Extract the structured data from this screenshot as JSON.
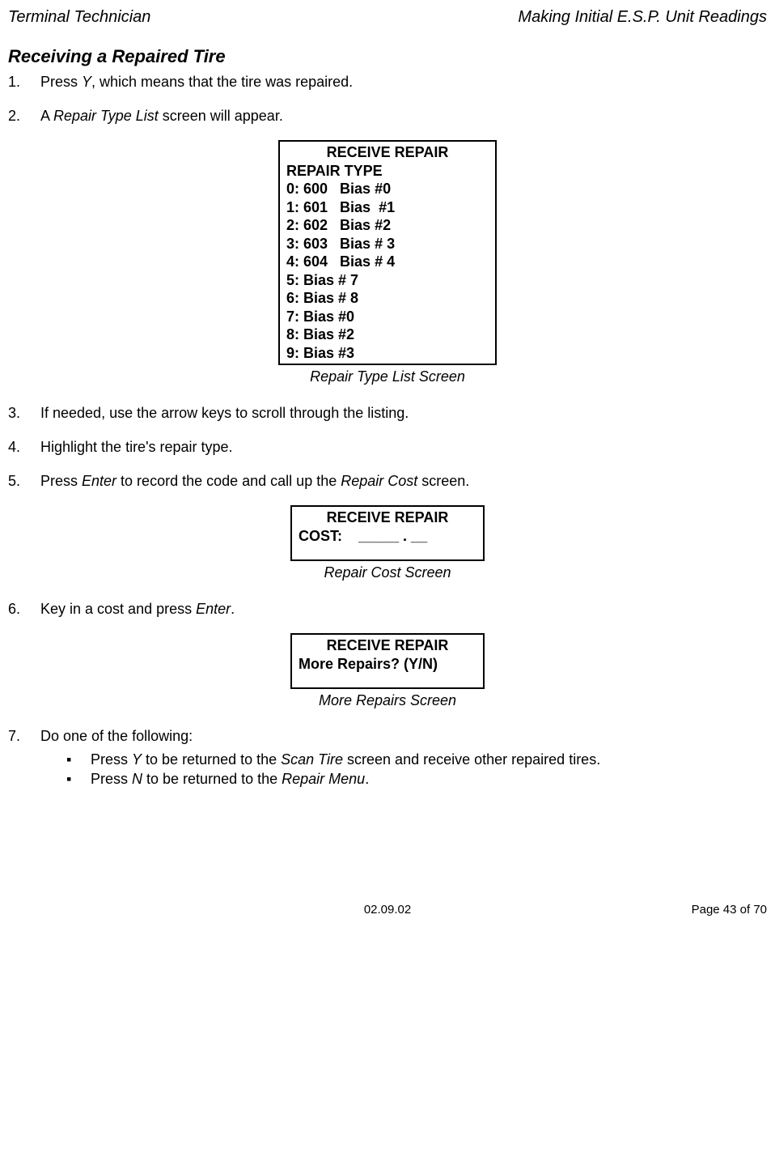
{
  "header": {
    "left": "Terminal Technician",
    "right": "Making Initial E.S.P. Unit Readings"
  },
  "sectionHeading": "Receiving a Repaired Tire",
  "steps": {
    "s1": {
      "num": "1.",
      "t1": "Press ",
      "key": "Y",
      "t2": ", which means that the tire was repaired."
    },
    "s2": {
      "num": "2.",
      "t1": "A ",
      "em": "Repair Type List",
      "t2": " screen will appear."
    },
    "s3": {
      "num": "3.",
      "t": "If needed, use the arrow keys to scroll through the listing."
    },
    "s4": {
      "num": "4.",
      "t": "Highlight the tire's repair type."
    },
    "s5": {
      "num": "5.",
      "t1": "Press ",
      "em1": "Enter",
      "t2": " to record the code and call up the ",
      "em2": "Repair Cost",
      "t3": " screen."
    },
    "s6": {
      "num": "6.",
      "t1": "Key in a cost and press ",
      "em": "Enter",
      "t2": "."
    },
    "s7": {
      "num": "7.",
      "t": "Do one of the following:",
      "b1": {
        "t1": "Press ",
        "key": "Y",
        "t2": " to be returned to the ",
        "em": "Scan Tire",
        "t3": " screen and receive other repaired tires."
      },
      "b2": {
        "t1": "Press ",
        "key": "N",
        "t2": " to be returned to the ",
        "em": "Repair Menu",
        "t3": "."
      }
    }
  },
  "screens": {
    "repairType": {
      "title": "RECEIVE REPAIR",
      "sub": "REPAIR TYPE",
      "r0": "0: 600   Bias #0",
      "r1": "1: 601   Bias  #1",
      "r2": "2: 602   Bias #2",
      "r3": "3: 603   Bias # 3",
      "r4": "4: 604   Bias # 4",
      "r5": "5: Bias # 7",
      "r6": "6: Bias # 8",
      "r7": "7: Bias #0",
      "r8": "8: Bias #2",
      "r9": "9: Bias #3",
      "caption": "Repair Type List Screen"
    },
    "repairCost": {
      "title": "RECEIVE REPAIR",
      "line": "COST:    _____ . __",
      "caption": "Repair Cost Screen"
    },
    "moreRepairs": {
      "title": "RECEIVE REPAIR",
      "line": "More Repairs? (Y/N)",
      "caption": "More Repairs Screen"
    }
  },
  "footer": {
    "date": "02.09.02",
    "page": "Page 43 of 70"
  }
}
